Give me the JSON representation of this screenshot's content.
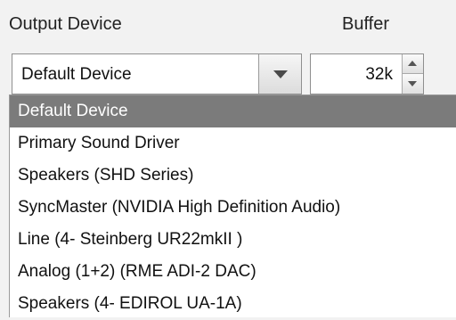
{
  "labels": {
    "output_device": "Output Device",
    "buffer": "Buffer"
  },
  "device_select": {
    "value": "Default Device"
  },
  "buffer_input": {
    "value": "32k"
  },
  "dropdown": {
    "items": [
      {
        "label": "Default Device",
        "selected": true
      },
      {
        "label": "Primary Sound Driver",
        "selected": false
      },
      {
        "label": "Speakers (SHD Series)",
        "selected": false
      },
      {
        "label": "SyncMaster (NVIDIA High Definition Audio)",
        "selected": false
      },
      {
        "label": "Line (4- Steinberg UR22mkII )",
        "selected": false
      },
      {
        "label": "Analog (1+2) (RME ADI-2 DAC)",
        "selected": false
      },
      {
        "label": "Speakers (4- EDIROL UA-1A)",
        "selected": false
      }
    ]
  },
  "colors": {
    "background": "#f2f2f2",
    "selected_item_bg": "#7b7b7b",
    "selected_item_fg": "#ffffff"
  },
  "icons": {
    "dropdown_arrow": "chevron-down-icon",
    "spinner_up": "spin-up-icon",
    "spinner_down": "spin-down-icon"
  }
}
